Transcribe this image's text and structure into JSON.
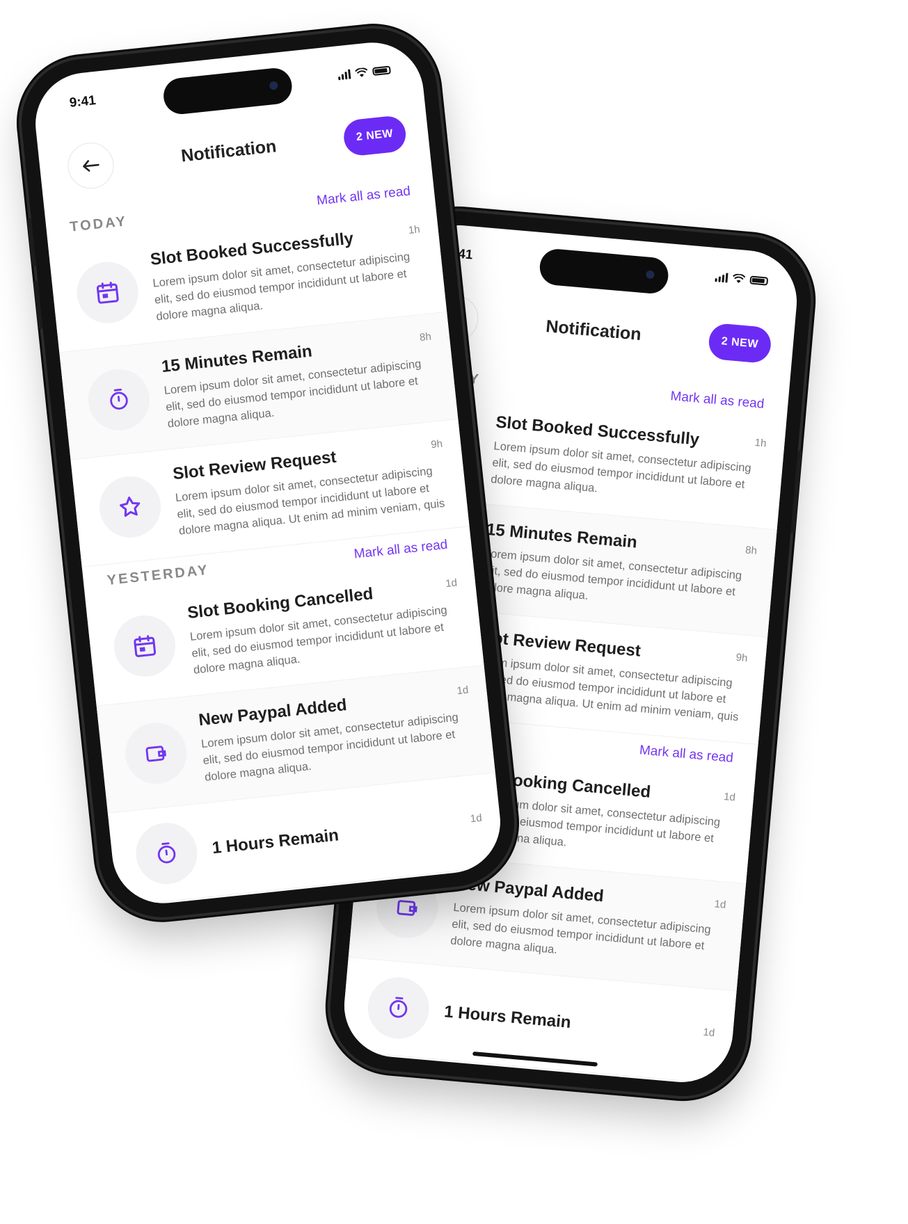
{
  "status": {
    "time": "9:41"
  },
  "header": {
    "title": "Notification",
    "badge": "2 NEW"
  },
  "actions": {
    "mark_all_read": "Mark all as read"
  },
  "sections": {
    "today": "TODAY",
    "yesterday": "YESTERDAY"
  },
  "notifications": [
    {
      "title": "Slot Booked Successfully",
      "time": "1h",
      "icon": "calendar-icon",
      "body": "Lorem ipsum dolor sit amet, consectetur adipiscing elit, sed do eiusmod tempor incididunt ut labore et dolore magna aliqua."
    },
    {
      "title": "15 Minutes Remain",
      "time": "8h",
      "icon": "timer-icon",
      "body": "Lorem ipsum dolor sit amet, consectetur adipiscing elit, sed do eiusmod tempor incididunt ut labore et dolore magna aliqua."
    },
    {
      "title": "Slot Review Request",
      "time": "9h",
      "icon": "star-icon",
      "body": "Lorem ipsum dolor sit amet, consectetur adipiscing elit, sed do eiusmod tempor incididunt ut labore et dolore magna aliqua. Ut enim ad minim veniam, quis"
    },
    {
      "title": "Slot Booking Cancelled",
      "time": "1d",
      "icon": "calendar-icon",
      "body": "Lorem ipsum dolor sit amet, consectetur adipiscing elit, sed do eiusmod tempor incididunt ut labore et dolore magna aliqua."
    },
    {
      "title": "New Paypal Added",
      "time": "1d",
      "icon": "wallet-icon",
      "body": "Lorem ipsum dolor sit amet, consectetur adipiscing elit, sed do eiusmod tempor incididunt ut labore et dolore magna aliqua."
    },
    {
      "title": "1 Hours Remain",
      "time": "1d",
      "icon": "timer-icon",
      "body": ""
    }
  ],
  "colors": {
    "accent": "#6c2bf5",
    "frame": "#121212"
  }
}
